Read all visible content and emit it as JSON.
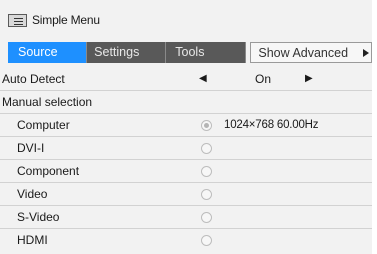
{
  "title": "Simple Menu",
  "tabs": [
    {
      "label": "Source",
      "active": true
    },
    {
      "label": "Settings",
      "active": false
    },
    {
      "label": "Tools",
      "active": false
    },
    {
      "label": "Show Advanced",
      "active": false
    }
  ],
  "auto_detect": {
    "label": "Auto Detect",
    "value": "On"
  },
  "manual_selection": {
    "label": "Manual selection"
  },
  "sources": [
    {
      "label": "Computer",
      "selected": true,
      "signal": "1024×768 60.00Hz"
    },
    {
      "label": "DVI-I",
      "selected": false,
      "signal": ""
    },
    {
      "label": "Component",
      "selected": false,
      "signal": ""
    },
    {
      "label": "Video",
      "selected": false,
      "signal": ""
    },
    {
      "label": "S-Video",
      "selected": false,
      "signal": ""
    },
    {
      "label": "HDMI",
      "selected": false,
      "signal": ""
    }
  ],
  "colors": {
    "active_tab": "#1e90ff",
    "inactive_tab": "#595959",
    "background": "#f2f2f2"
  }
}
